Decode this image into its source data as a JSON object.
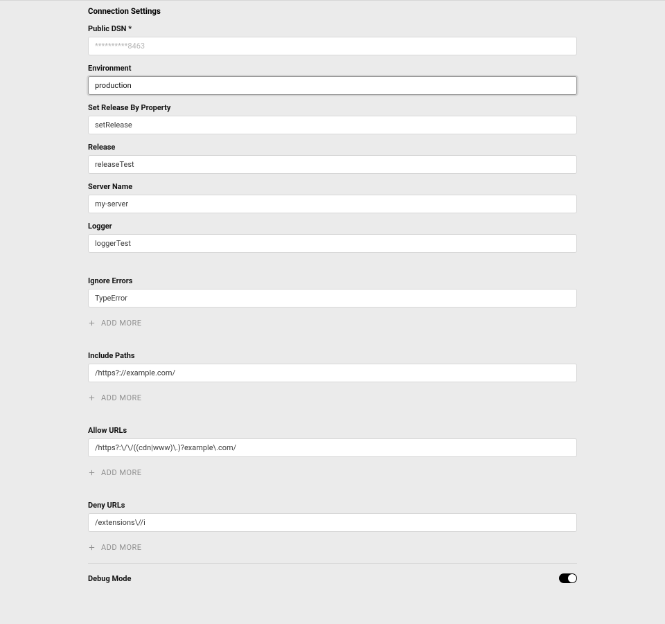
{
  "section_title": "Connection Settings",
  "add_more_label": "ADD MORE",
  "fields": {
    "public_dsn": {
      "label": "Public DSN",
      "required_mark": "*",
      "placeholder": "**********8463",
      "value": ""
    },
    "environment": {
      "label": "Environment",
      "value": "production"
    },
    "set_release_by_property": {
      "label": "Set Release By Property",
      "value": "setRelease"
    },
    "release": {
      "label": "Release",
      "value": "releaseTest"
    },
    "server_name": {
      "label": "Server Name",
      "value": "my-server"
    },
    "logger": {
      "label": "Logger",
      "value": "loggerTest"
    }
  },
  "ignore_errors": {
    "label": "Ignore Errors",
    "items": [
      "TypeError"
    ]
  },
  "include_paths": {
    "label": "Include Paths",
    "items": [
      "/https?://example.com/"
    ]
  },
  "allow_urls": {
    "label": "Allow URLs",
    "items": [
      "/https?:\\/\\/((cdn|www)\\.)?example\\.com/"
    ]
  },
  "deny_urls": {
    "label": "Deny URLs",
    "items": [
      "/extensions\\//i"
    ]
  },
  "debug_mode": {
    "label": "Debug Mode",
    "enabled": true
  }
}
